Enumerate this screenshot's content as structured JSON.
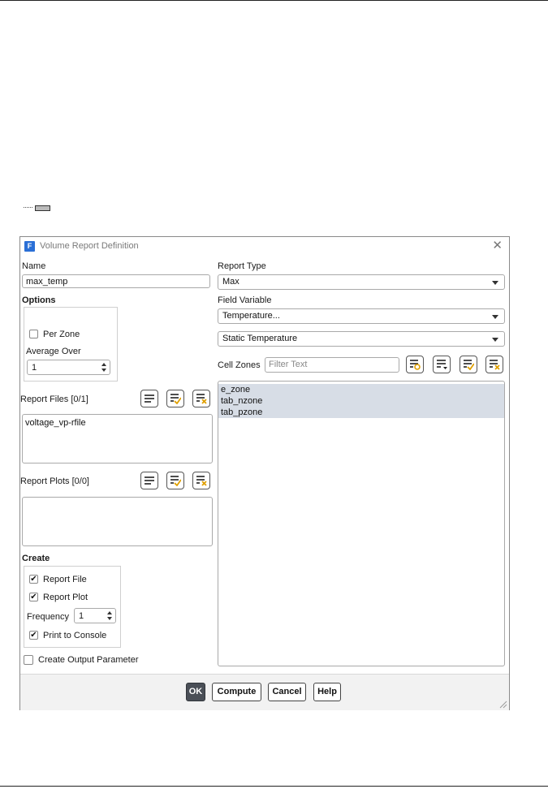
{
  "dialog": {
    "title": "Volume Report Definition",
    "app_icon_letter": "F"
  },
  "name": {
    "label": "Name",
    "value": "max_temp"
  },
  "options": {
    "label": "Options",
    "per_zone": {
      "label": "Per Zone",
      "checked": false
    },
    "average_over": {
      "label": "Average Over",
      "value": "1"
    }
  },
  "report_files": {
    "label": "Report Files [0/1]",
    "items": [
      "voltage_vp-rfile"
    ]
  },
  "report_plots": {
    "label": "Report Plots [0/0]",
    "items": []
  },
  "create": {
    "label": "Create",
    "report_file": {
      "label": "Report File",
      "checked": true
    },
    "report_plot": {
      "label": "Report Plot",
      "checked": true
    },
    "frequency": {
      "label": "Frequency",
      "value": "1"
    },
    "print_to_console": {
      "label": "Print to Console",
      "checked": true
    }
  },
  "create_output_parameter": {
    "label": "Create Output Parameter",
    "checked": false
  },
  "report_type": {
    "label": "Report Type",
    "value": "Max"
  },
  "field_variable": {
    "label": "Field Variable",
    "category": "Temperature...",
    "value": "Static Temperature"
  },
  "cell_zones": {
    "label": "Cell Zones",
    "filter_placeholder": "Filter Text",
    "items": [
      "e_zone",
      "tab_nzone",
      "tab_pzone"
    ]
  },
  "buttons": {
    "ok": "OK",
    "compute": "Compute",
    "cancel": "Cancel",
    "help": "Help"
  },
  "colors": {
    "accent": "#2a6fd6",
    "selection": "#d7dde6",
    "primary_button": "#4a4f57"
  },
  "icons": {
    "list_tools": [
      "select-all-icon",
      "select-checked-icon",
      "deselect-all-icon"
    ],
    "zone_tools": [
      "match-zones-icon",
      "list-options-icon",
      "select-checked-icon",
      "deselect-all-icon"
    ]
  }
}
